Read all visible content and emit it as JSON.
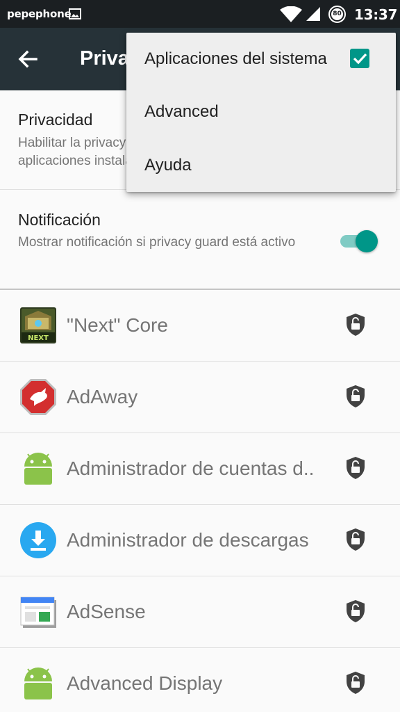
{
  "status_bar": {
    "carrier": "pepephone",
    "battery": "80",
    "time": "13:37",
    "icons": [
      "image-notification-icon",
      "wifi-icon",
      "cell-signal-icon",
      "battery-icon"
    ]
  },
  "toolbar": {
    "title": "Privacy guard",
    "back_icon": "arrow-back-icon",
    "background": "#263238"
  },
  "preferences": [
    {
      "title": "Privacidad",
      "summary": "Habilitar la privacy guard para las nuevas aplicaciones instaladas"
    },
    {
      "title": "Notificación",
      "summary": "Mostrar notificación si privacy guard está activo",
      "switch_on": true
    }
  ],
  "apps": [
    {
      "name": "\"Next\" Core",
      "icon": "next-launcher-icon",
      "icon_text": "NEXT"
    },
    {
      "name": "AdAway",
      "icon": "adaway-icon"
    },
    {
      "name": "Administrador de cuentas d..",
      "icon": "android-icon"
    },
    {
      "name": "Administrador de descargas",
      "icon": "download-manager-icon"
    },
    {
      "name": "AdSense",
      "icon": "adsense-icon"
    },
    {
      "name": "Advanced Display",
      "icon": "android-icon"
    }
  ],
  "overflow_menu": {
    "items": [
      {
        "label": "Aplicaciones del sistema",
        "checked": true
      },
      {
        "label": "Advanced"
      },
      {
        "label": "Ayuda"
      }
    ]
  },
  "colors": {
    "accent": "#009688",
    "android_green": "#8bc34a",
    "shield": "#424242"
  }
}
